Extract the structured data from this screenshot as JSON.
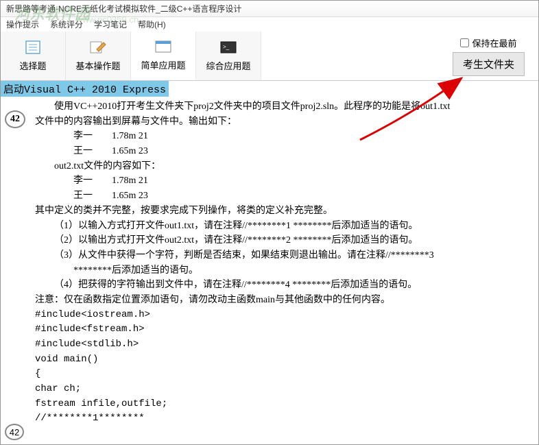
{
  "window": {
    "title": "新思路等考通·NCRE无纸化考试模拟软件_二级C++语言程序设计"
  },
  "watermark": {
    "main": "河东软件园",
    "sub": "www.pc0359.cn"
  },
  "menu": {
    "tip": "操作提示",
    "sysScore": "系统评分",
    "notes": "学习笔记",
    "help": "帮助(H)"
  },
  "tabs": {
    "choice": "选择题",
    "basic": "基本操作题",
    "simple": "简单应用题",
    "composite": "综合应用题"
  },
  "topRight": {
    "keepFront": "保持在最前",
    "examFolder": "考生文件夹"
  },
  "content": {
    "launch": "启动Visual C++ 2010 Express",
    "qnum": "42",
    "p1": "使用VC++2010打开考生文件夹下proj2文件夹中的项目文件proj2.sln。此程序的功能是将out1.txt",
    "p2": "文件中的内容输出到屏幕与文件中。输出如下：",
    "li1": "李一　　1.78m  21",
    "li2": "王一　　1.65m  23",
    "o2": "out2.txt文件的内容如下：",
    "li3": "李一　　1.78m  21",
    "li4": "王一　　1.65m  23",
    "p3": "其中定义的类并不完整，按要求完成下列操作，将类的定义补充完整。",
    "s1": "（1）以输入方式打开文件out1.txt，请在注释//********1 ********后添加适当的语句。",
    "s2": "（2）以输出方式打开文件out2.txt，请在注释//********2 ********后添加适当的语句。",
    "s3a": "（3）从文件中获得一个字符，判断是否结束，如果结束则退出输出。请在注释//********3",
    "s3b": "********后添加适当的语句。",
    "s4": "（4）把获得的字符输出到文件中，请在注释//********4 ********后添加适当的语句。",
    "note": "注意：仅在函数指定位置添加语句，请勿改动主函数main与其他函数中的任何内容。",
    "c1": "#include<iostream.h>",
    "c2": "#include<fstream.h>",
    "c3": "#include<stdlib.h>",
    "c4": "void main()",
    "c5": "{",
    "c6": "char ch;",
    "c7": "fstream infile,outfile;",
    "c8": "//********1********"
  },
  "footer": {
    "num": "42"
  }
}
